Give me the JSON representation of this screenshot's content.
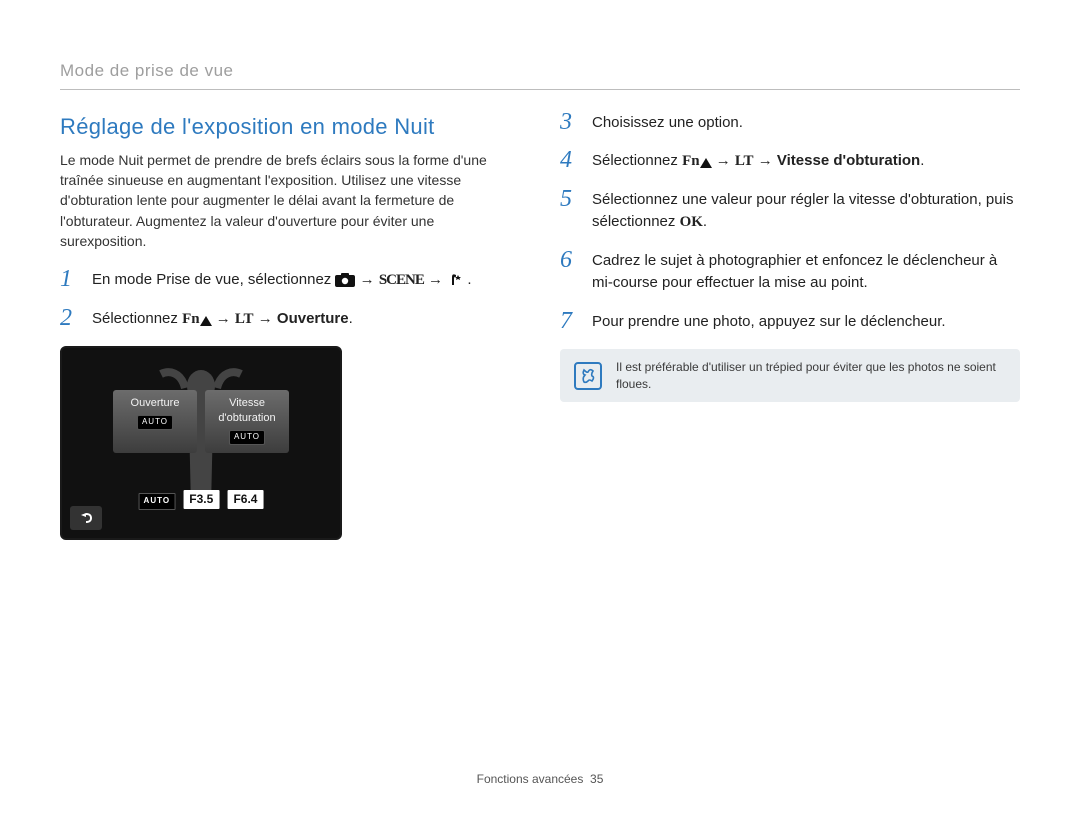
{
  "header": {
    "section": "Mode de prise de vue"
  },
  "title": "Réglage de l'exposition en mode Nuit",
  "intro": "Le mode Nuit permet de prendre de brefs éclairs sous la forme d'une traînée sinueuse en augmentant l'exposition. Utilisez une vitesse d'obturation lente pour augmenter le délai avant la fermeture de l'obturateur. Augmentez la valeur d'ouverture pour éviter une surexposition.",
  "steps_left": [
    {
      "n": "1",
      "pre": "En mode Prise de vue, sélectionnez ",
      "arrow": " → ",
      "mid2": " → ",
      "end": "."
    },
    {
      "n": "2",
      "pre": "Sélectionnez ",
      "arrow": " → ",
      "mid2": " → ",
      "bold": "Ouverture",
      "end": "."
    }
  ],
  "lcd": {
    "panel_left": "Ouverture",
    "panel_right_a": "Vitesse",
    "panel_right_b": "d'obturation",
    "auto": "AUTO",
    "val1": "F3.5",
    "val2": "F6.4"
  },
  "steps_right": [
    {
      "n": "3",
      "text": "Choisissez une option."
    },
    {
      "n": "4",
      "pre": "Sélectionnez ",
      "arrow": " → ",
      "mid2": " → ",
      "bold": "Vitesse d'obturation",
      "end": "."
    },
    {
      "n": "5",
      "pre": "Sélectionnez une valeur pour régler la vitesse d'obturation, puis sélectionnez ",
      "end": "."
    },
    {
      "n": "6",
      "text": "Cadrez le sujet à photographier et enfoncez le déclencheur à mi-course pour effectuer la mise au point."
    },
    {
      "n": "7",
      "text": "Pour prendre une photo, appuyez sur le déclencheur."
    }
  ],
  "note": "Il est préférable d'utiliser un trépied pour éviter que les photos ne soient floues.",
  "footer": {
    "label": "Fonctions avancées",
    "page": "35"
  },
  "glyphs": {
    "fn": "Fn",
    "lt": "LT",
    "scene": "SCENE",
    "ok": "OK"
  }
}
